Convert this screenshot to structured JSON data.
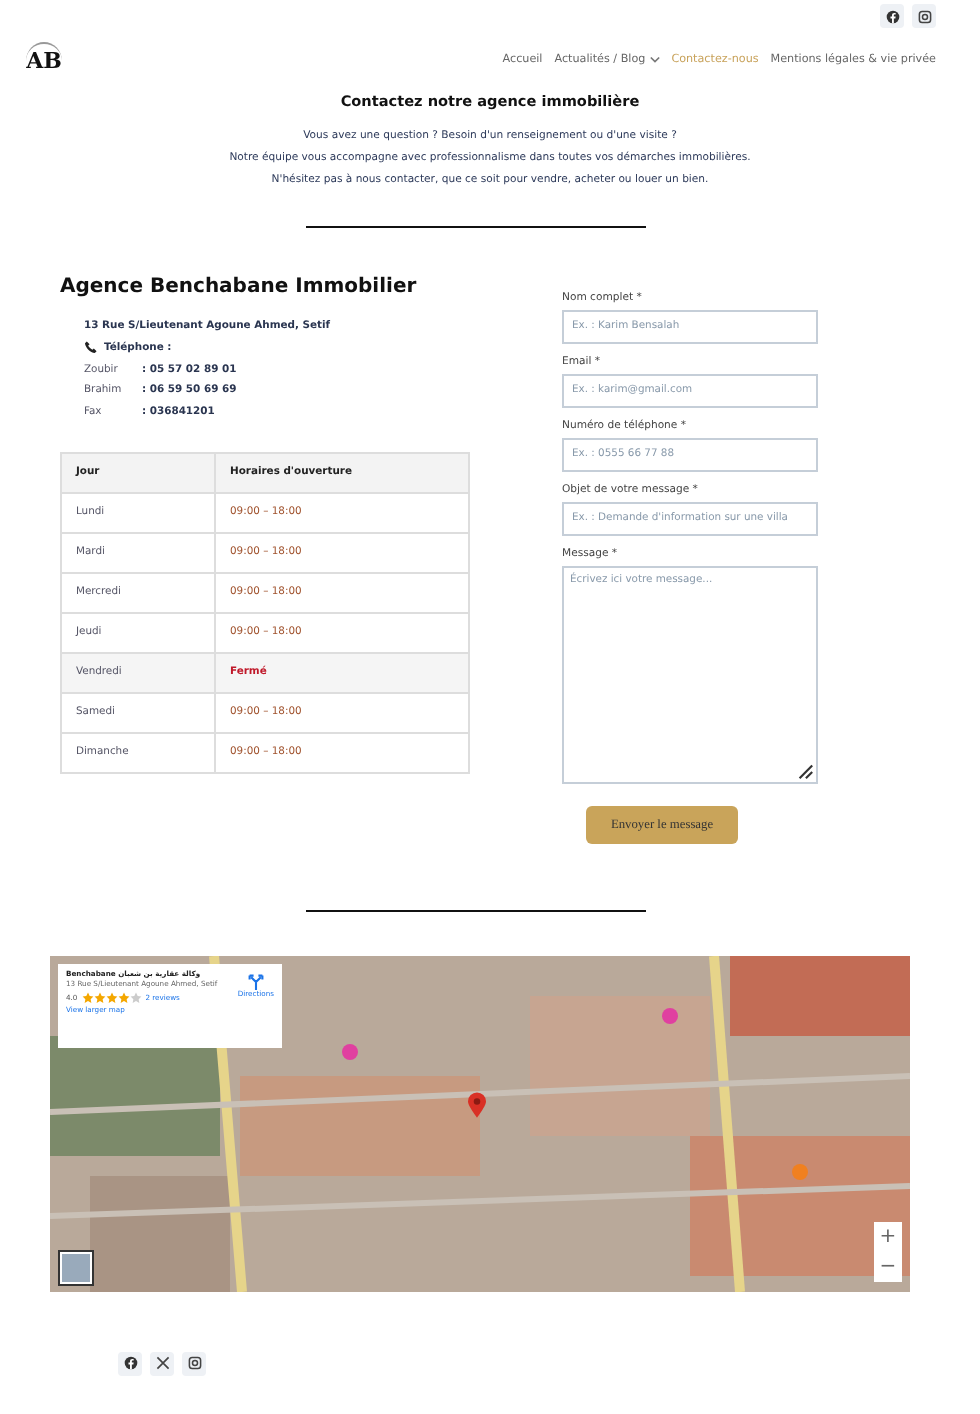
{
  "logo": {
    "text": "AB"
  },
  "social_top": [
    {
      "kind": "facebook"
    },
    {
      "kind": "instagram"
    }
  ],
  "nav": [
    {
      "label": "Accueil",
      "selected": false,
      "dropdown": false
    },
    {
      "label": "Actualités / Blog",
      "selected": false,
      "dropdown": true
    },
    {
      "label": "Contactez-nous",
      "selected": true,
      "dropdown": false
    },
    {
      "label": "Mentions légales & vie privée",
      "selected": false,
      "dropdown": false
    }
  ],
  "heading": "Contactez notre agence immobilière",
  "intro": [
    "Vous avez une question ? Besoin d'un renseignement ou d'une visite ?",
    "Notre équipe vous accompagne avec professionnalisme dans toutes vos démarches immobilières.",
    "N'hésitez pas à nous contacter, que ce soit pour vendre, acheter ou louer un bien."
  ],
  "agency": {
    "name": "Agence Benchabane Immobilier",
    "details": [
      {
        "kind": "address",
        "text": "13 Rue S/Lieutenant Agoune Ahmed, Setif"
      },
      {
        "kind": "phone-heading",
        "text": "Téléphone :"
      },
      {
        "kind": "contact",
        "label": "Zoubir",
        "value": ": 05 57 02 89 01"
      },
      {
        "kind": "contact",
        "label": "Brahim",
        "value": ": 06 59 50 69 69"
      },
      {
        "kind": "contact",
        "label": "Fax",
        "value": ":  036841201"
      }
    ]
  },
  "hours": {
    "columns": [
      "Jour",
      "Horaires d'ouverture"
    ],
    "rows": [
      {
        "day": "Lundi",
        "hours": "09:00 – 18:00",
        "closed": false
      },
      {
        "day": "Mardi",
        "hours": "09:00 – 18:00",
        "closed": false
      },
      {
        "day": "Mercredi",
        "hours": "09:00 – 18:00",
        "closed": false
      },
      {
        "day": "Jeudi",
        "hours": "09:00 – 18:00",
        "closed": false
      },
      {
        "day": "Vendredi",
        "hours": "Fermé",
        "closed": true
      },
      {
        "day": "Samedi",
        "hours": "09:00 – 18:00",
        "closed": false
      },
      {
        "day": "Dimanche",
        "hours": "09:00 – 18:00",
        "closed": false
      }
    ]
  },
  "form": {
    "fields": [
      {
        "kind": "input",
        "label": "Nom complet *",
        "placeholder": "Ex. : Karim Bensalah"
      },
      {
        "kind": "input",
        "label": "Email *",
        "placeholder": "Ex. : karim@gmail.com"
      },
      {
        "kind": "input",
        "label": "Numéro de téléphone *",
        "placeholder": "Ex. : 0555 66 77 88"
      },
      {
        "kind": "input",
        "label": "Objet de votre message *",
        "placeholder": "Ex. : Demande d'information sur une villa"
      },
      {
        "kind": "textarea",
        "label": "Message *",
        "placeholder": "Écrivez ici votre message..."
      }
    ],
    "submit": "Envoyer le message"
  },
  "map": {
    "card": {
      "name": "Benchabane وكالة عقارية بن شعبان",
      "address": "13 Rue S/Lieutenant Agoune Ahmed, Setif",
      "rating": "4.0",
      "stars": 4,
      "reviews": "2 reviews",
      "larger": "View larger map",
      "directions": "Directions"
    },
    "zoom_in": "+",
    "zoom_out": "−"
  },
  "social_bottom": [
    {
      "kind": "facebook"
    },
    {
      "kind": "x"
    },
    {
      "kind": "instagram"
    }
  ]
}
